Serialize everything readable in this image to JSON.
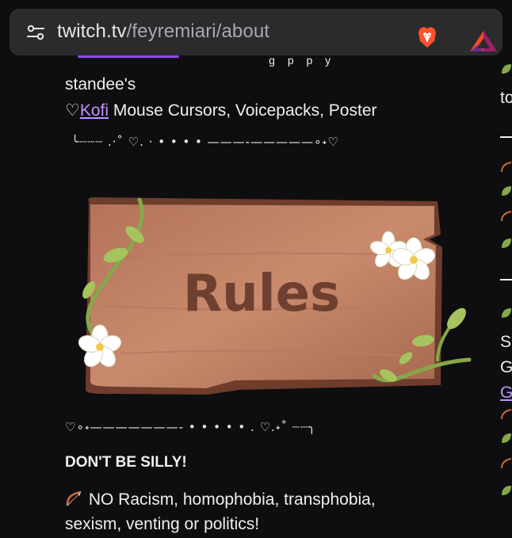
{
  "browser": {
    "url_host": "twitch.tv",
    "url_path": "/feyremiari/about",
    "site_settings_icon": "tune-icon",
    "shield_icon": "brave-lion-icon",
    "rewards_icon": "bat-triangle-icon"
  },
  "about": {
    "line_standees": "standee's",
    "heart": "♡",
    "kofi_link": "Kofi",
    "kofi_rest": " Mouse Cursors, Voicepacks, Poster",
    "divider_top": "╰┈┈┈ .·˚ ♡. · • • • • ———-—————∘˖♡",
    "rules_panel_text": "Rules",
    "divider_bottom": "♡∘˖———————-  • • • • • . ♡.˖˚ ┈┈╮",
    "rules_heading": "DON'T BE SILLY!",
    "rule_icon": "bow-and-arrow-icon",
    "rule_1_line_1": "NO Racism, homophobia, transphobia,",
    "rule_1_line_2": "sexism, venting or politics!"
  },
  "right_column": {
    "frag_to": "to",
    "frag_s": "S",
    "frag_g": "G",
    "frag_g_link": "G"
  },
  "colors": {
    "background": "#0e0e10",
    "text": "#efeff1",
    "link": "#bf94ff",
    "urlbar": "#2b2b2e",
    "brave_orange": "#fb542b"
  }
}
